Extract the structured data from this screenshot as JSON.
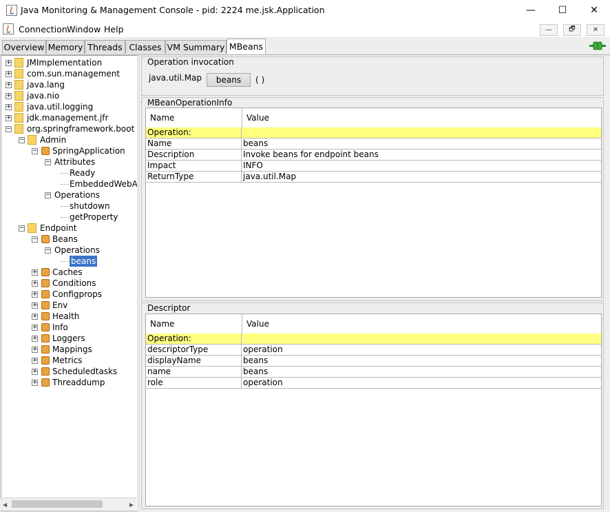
{
  "window": {
    "title": "Java Monitoring & Management Console - pid: 2224 me.jsk.Application",
    "minimize_glyph": "—",
    "maximize_glyph": "☐",
    "close_glyph": "✕"
  },
  "menu": {
    "items": [
      "Connection",
      "Window",
      "Help"
    ],
    "mdi_buttons": [
      "—",
      "🗗",
      "✕"
    ]
  },
  "tabs": [
    {
      "label": "Overview",
      "active": false
    },
    {
      "label": "Memory",
      "active": false
    },
    {
      "label": "Threads",
      "active": false
    },
    {
      "label": "Classes",
      "active": false
    },
    {
      "label": "VM Summary",
      "active": false
    },
    {
      "label": "MBeans",
      "active": true
    }
  ],
  "tree": [
    {
      "label": "JMImplementation",
      "icon": "folder-icon",
      "expander": "+"
    },
    {
      "label": "com.sun.management",
      "icon": "folder-icon",
      "expander": "+"
    },
    {
      "label": "java.lang",
      "icon": "folder-icon",
      "expander": "+"
    },
    {
      "label": "java.nio",
      "icon": "folder-icon",
      "expander": "+"
    },
    {
      "label": "java.util.logging",
      "icon": "folder-icon",
      "expander": "+"
    },
    {
      "label": "jdk.management.jfr",
      "icon": "folder-icon",
      "expander": "+"
    },
    {
      "label": "org.springframework.boot",
      "icon": "folder-icon",
      "expander": "-"
    },
    {
      "label": "Admin",
      "icon": "folder-icon",
      "expander": "-"
    },
    {
      "label": "SpringApplication",
      "icon": "bean-icon",
      "expander": "-"
    },
    {
      "label": "Attributes",
      "icon": "",
      "expander": "-"
    },
    {
      "label": "Ready",
      "icon": "",
      "expander": ""
    },
    {
      "label": "EmbeddedWebAp",
      "icon": "",
      "expander": ""
    },
    {
      "label": "Operations",
      "icon": "",
      "expander": "-"
    },
    {
      "label": "shutdown",
      "icon": "",
      "expander": ""
    },
    {
      "label": "getProperty",
      "icon": "",
      "expander": ""
    },
    {
      "label": "Endpoint",
      "icon": "folder-icon",
      "expander": "-"
    },
    {
      "label": "Beans",
      "icon": "bean-icon",
      "expander": "-"
    },
    {
      "label": "Operations",
      "icon": "",
      "expander": "-"
    },
    {
      "label": "beans",
      "icon": "",
      "expander": "",
      "selected": true
    },
    {
      "label": "Caches",
      "icon": "bean-icon",
      "expander": "+"
    },
    {
      "label": "Conditions",
      "icon": "bean-icon",
      "expander": "+"
    },
    {
      "label": "Configprops",
      "icon": "bean-icon",
      "expander": "+"
    },
    {
      "label": "Env",
      "icon": "bean-icon",
      "expander": "+"
    },
    {
      "label": "Health",
      "icon": "bean-icon",
      "expander": "+"
    },
    {
      "label": "Info",
      "icon": "bean-icon",
      "expander": "+"
    },
    {
      "label": "Loggers",
      "icon": "bean-icon",
      "expander": "+"
    },
    {
      "label": "Mappings",
      "icon": "bean-icon",
      "expander": "+"
    },
    {
      "label": "Metrics",
      "icon": "bean-icon",
      "expander": "+"
    },
    {
      "label": "Scheduledtasks",
      "icon": "bean-icon",
      "expander": "+"
    },
    {
      "label": "Threaddump",
      "icon": "bean-icon",
      "expander": "+"
    }
  ],
  "operation_invocation": {
    "label": "Operation invocation",
    "return_type": "java.util.Map",
    "button": "beans",
    "params": "( )"
  },
  "mbean_operation_info": {
    "label": "MBeanOperationInfo",
    "columns": [
      "Name",
      "Value"
    ],
    "rows": [
      {
        "name": "Operation:",
        "value": "",
        "highlight": true
      },
      {
        "name": "Name",
        "value": "beans"
      },
      {
        "name": "Description",
        "value": "Invoke beans for endpoint beans"
      },
      {
        "name": "Impact",
        "value": "INFO"
      },
      {
        "name": "ReturnType",
        "value": "java.util.Map"
      }
    ]
  },
  "descriptor": {
    "label": "Descriptor",
    "columns": [
      "Name",
      "Value"
    ],
    "rows": [
      {
        "name": "Operation:",
        "value": "",
        "highlight": true
      },
      {
        "name": "descriptorType",
        "value": "operation"
      },
      {
        "name": "displayName",
        "value": "beans"
      },
      {
        "name": "name",
        "value": "beans"
      },
      {
        "name": "role",
        "value": "operation"
      }
    ]
  },
  "colors": {
    "selection": "#3a74c7",
    "highlight_row": "#ffff80",
    "connection_indicator": "#3cae3c"
  }
}
